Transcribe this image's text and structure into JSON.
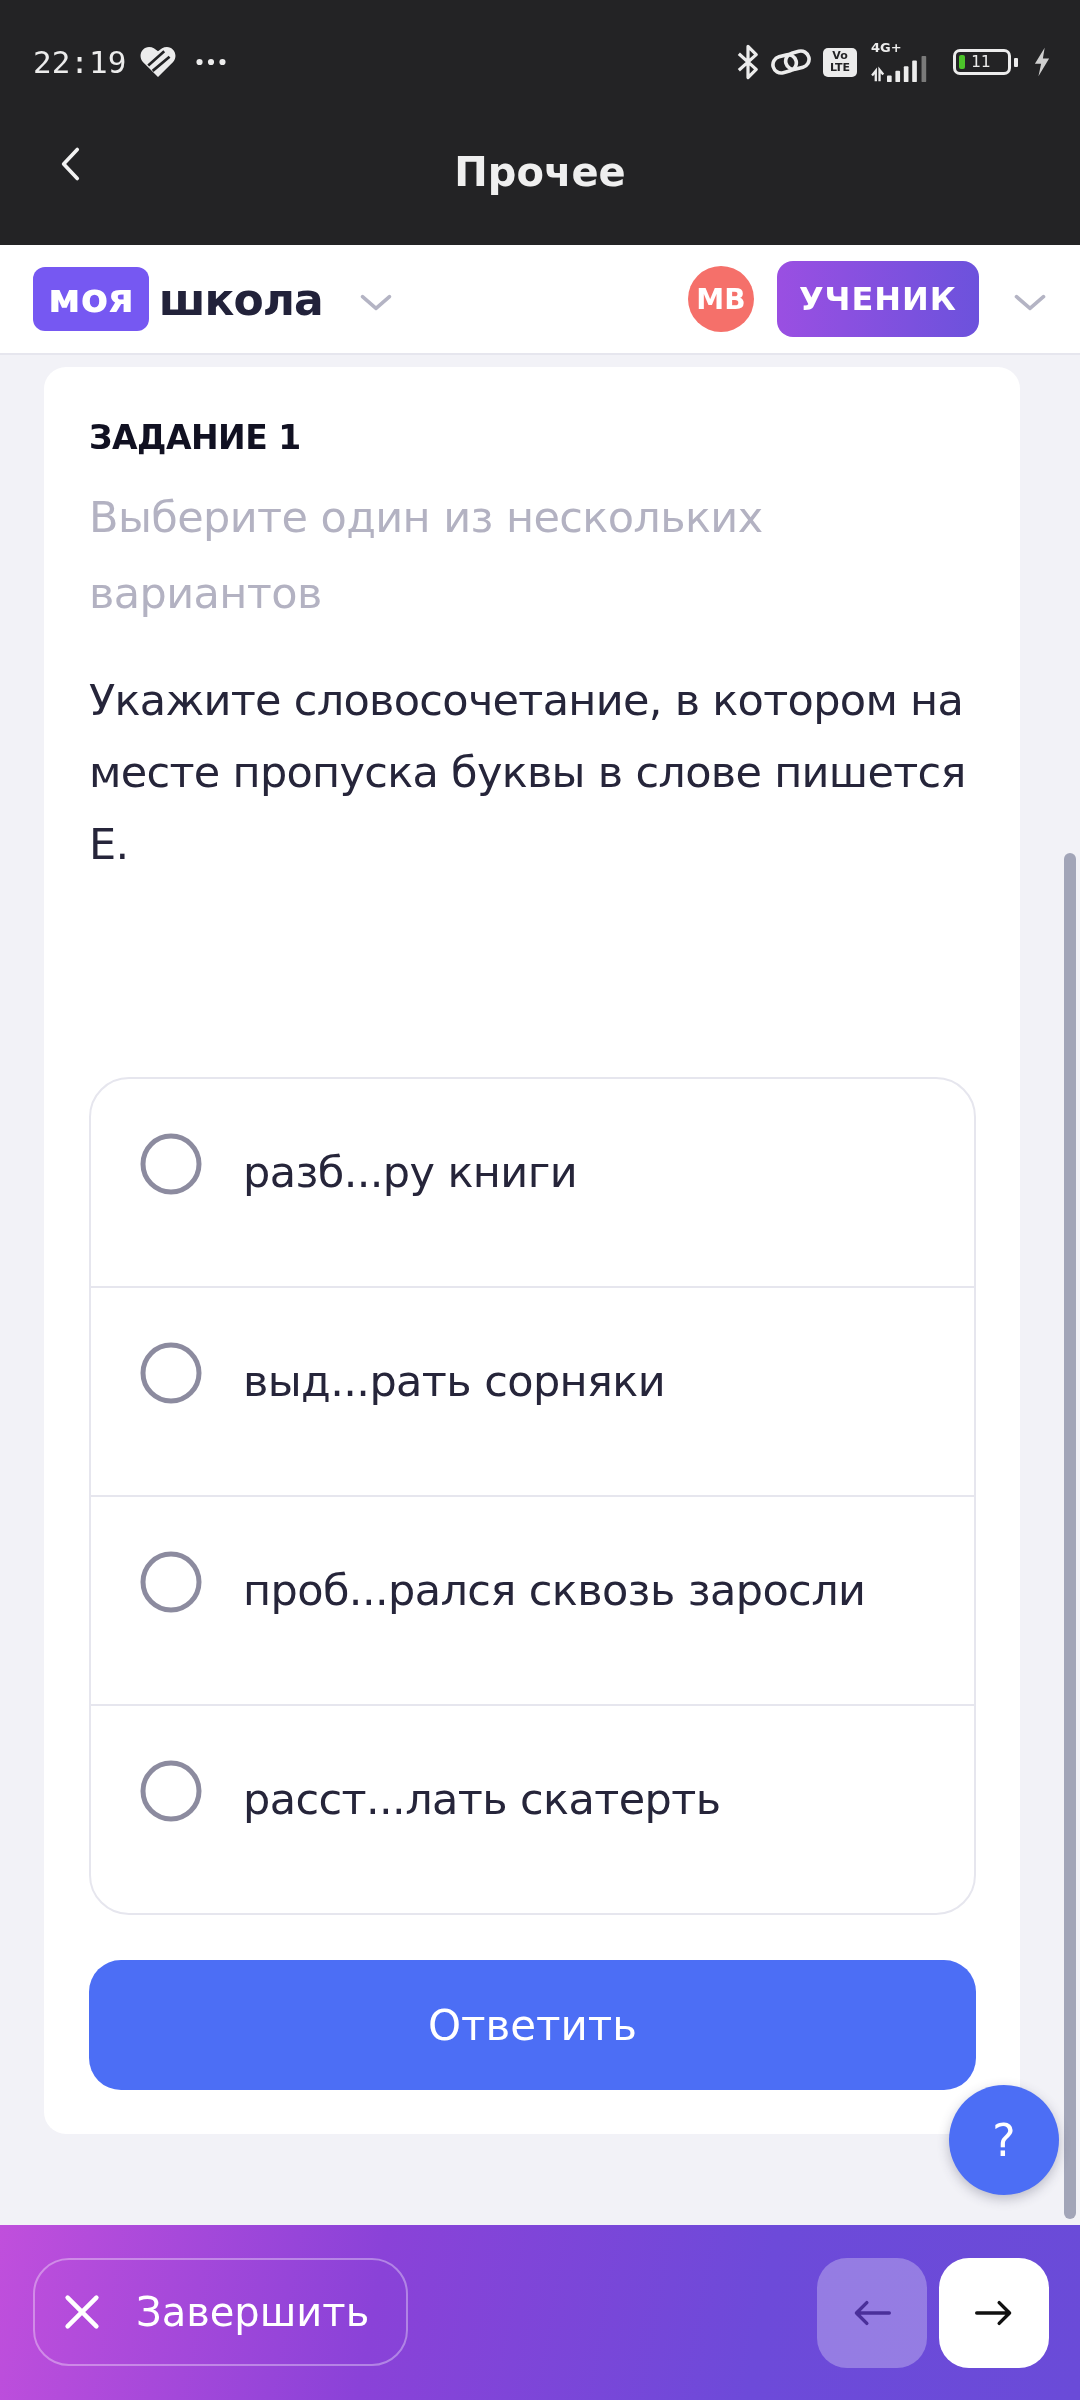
{
  "status_bar": {
    "time": "22:19",
    "volte": [
      "Vo",
      "LTE"
    ],
    "network": "4G+",
    "battery": "11"
  },
  "app_bar": {
    "title": "Прочее"
  },
  "header": {
    "logo_badge": "моя",
    "logo_text": "школа",
    "avatar": "МВ",
    "role": "УЧЕНИК"
  },
  "task": {
    "label": "ЗАДАНИЕ 1",
    "instruction": "Выберите один из нескольких вариантов",
    "question": "Укажите словосочетание, в котором на месте пропуска буквы в слове пишется Е.",
    "options": [
      {
        "text": "разб...ру книги",
        "selected": false
      },
      {
        "text": "выд...рать сорняки",
        "selected": false
      },
      {
        "text": "проб...рался сквозь заросли",
        "selected": false
      },
      {
        "text": "расст...лать скатерть",
        "selected": false
      }
    ],
    "submit": "Ответить"
  },
  "help_button": "?",
  "bottom_bar": {
    "finish": "Завершить",
    "nav": [
      {
        "kind": "prev",
        "disabled": true
      },
      {
        "kind": "next",
        "disabled": false
      }
    ]
  }
}
